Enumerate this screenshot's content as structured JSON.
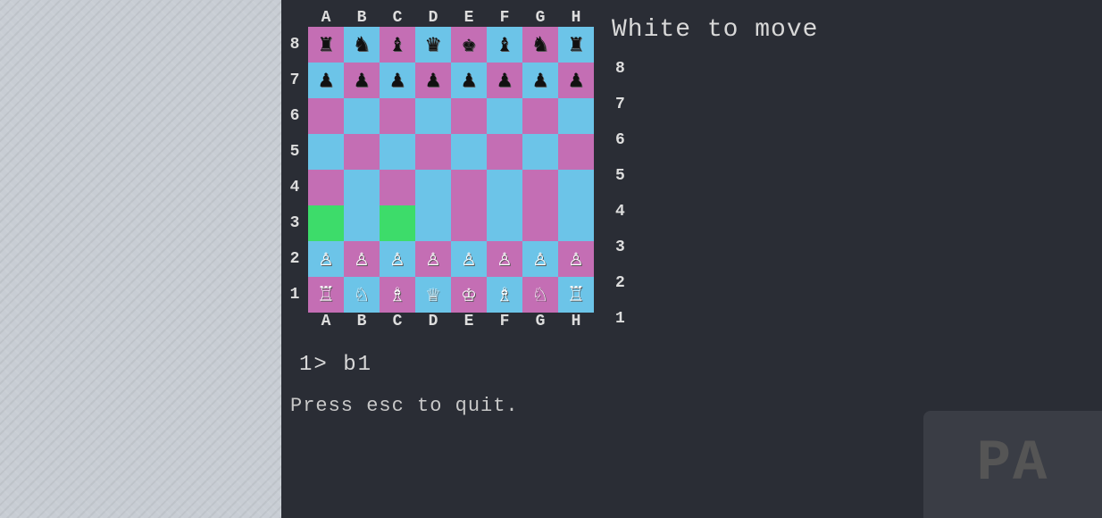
{
  "app": {
    "status": "White to move",
    "move_indicator": "1>  b1",
    "esc_hint": "Press esc to quit.",
    "pa_decor": "PA"
  },
  "board": {
    "col_labels": [
      "A",
      "B",
      "C",
      "D",
      "E",
      "F",
      "G",
      "H"
    ],
    "rows": [
      {
        "label": "8",
        "cells": [
          {
            "color": "dark",
            "piece": "♜",
            "side": "black"
          },
          {
            "color": "light",
            "piece": "♞",
            "side": "black"
          },
          {
            "color": "dark",
            "piece": "♝",
            "side": "black"
          },
          {
            "color": "light",
            "piece": "♛",
            "side": "black"
          },
          {
            "color": "dark",
            "piece": "♚",
            "side": "black"
          },
          {
            "color": "light",
            "piece": "♝",
            "side": "black"
          },
          {
            "color": "dark",
            "piece": "♞",
            "side": "black"
          },
          {
            "color": "light",
            "piece": "♜",
            "side": "black"
          }
        ]
      },
      {
        "label": "7",
        "cells": [
          {
            "color": "light",
            "piece": "♟",
            "side": "black"
          },
          {
            "color": "dark",
            "piece": "♟",
            "side": "black"
          },
          {
            "color": "light",
            "piece": "♟",
            "side": "black"
          },
          {
            "color": "dark",
            "piece": "♟",
            "side": "black"
          },
          {
            "color": "light",
            "piece": "♟",
            "side": "black"
          },
          {
            "color": "dark",
            "piece": "♟",
            "side": "black"
          },
          {
            "color": "light",
            "piece": "♟",
            "side": "black"
          },
          {
            "color": "dark",
            "piece": "♟",
            "side": "black"
          }
        ]
      },
      {
        "label": "6",
        "cells": [
          {
            "color": "dark",
            "piece": "",
            "side": ""
          },
          {
            "color": "light",
            "piece": "",
            "side": ""
          },
          {
            "color": "dark",
            "piece": "",
            "side": ""
          },
          {
            "color": "light",
            "piece": "",
            "side": ""
          },
          {
            "color": "dark",
            "piece": "",
            "side": ""
          },
          {
            "color": "light",
            "piece": "",
            "side": ""
          },
          {
            "color": "dark",
            "piece": "",
            "side": ""
          },
          {
            "color": "light",
            "piece": "",
            "side": ""
          }
        ]
      },
      {
        "label": "5",
        "cells": [
          {
            "color": "light",
            "piece": "",
            "side": ""
          },
          {
            "color": "dark",
            "piece": "",
            "side": ""
          },
          {
            "color": "light",
            "piece": "",
            "side": ""
          },
          {
            "color": "dark",
            "piece": "",
            "side": ""
          },
          {
            "color": "light",
            "piece": "",
            "side": ""
          },
          {
            "color": "dark",
            "piece": "",
            "side": ""
          },
          {
            "color": "light",
            "piece": "",
            "side": ""
          },
          {
            "color": "dark",
            "piece": "",
            "side": ""
          }
        ]
      },
      {
        "label": "4",
        "cells": [
          {
            "color": "dark",
            "piece": "",
            "side": ""
          },
          {
            "color": "light",
            "piece": "",
            "side": ""
          },
          {
            "color": "dark",
            "piece": "",
            "side": ""
          },
          {
            "color": "light",
            "piece": "",
            "side": ""
          },
          {
            "color": "dark",
            "piece": "",
            "side": ""
          },
          {
            "color": "light",
            "piece": "",
            "side": ""
          },
          {
            "color": "dark",
            "piece": "",
            "side": ""
          },
          {
            "color": "light",
            "piece": "",
            "side": ""
          }
        ]
      },
      {
        "label": "3",
        "cells": [
          {
            "color": "highlight",
            "piece": "",
            "side": ""
          },
          {
            "color": "light",
            "piece": "",
            "side": ""
          },
          {
            "color": "highlight",
            "piece": "",
            "side": ""
          },
          {
            "color": "light",
            "piece": "",
            "side": ""
          },
          {
            "color": "dark",
            "piece": "",
            "side": ""
          },
          {
            "color": "light",
            "piece": "",
            "side": ""
          },
          {
            "color": "dark",
            "piece": "",
            "side": ""
          },
          {
            "color": "light",
            "piece": "",
            "side": ""
          }
        ]
      },
      {
        "label": "2",
        "cells": [
          {
            "color": "light",
            "piece": "♙",
            "side": "white"
          },
          {
            "color": "dark",
            "piece": "♙",
            "side": "white"
          },
          {
            "color": "light",
            "piece": "♙",
            "side": "white"
          },
          {
            "color": "dark",
            "piece": "♙",
            "side": "white"
          },
          {
            "color": "light",
            "piece": "♙",
            "side": "white"
          },
          {
            "color": "dark",
            "piece": "♙",
            "side": "white"
          },
          {
            "color": "light",
            "piece": "♙",
            "side": "white"
          },
          {
            "color": "dark",
            "piece": "♙",
            "side": "white"
          }
        ]
      },
      {
        "label": "1",
        "cells": [
          {
            "color": "dark",
            "piece": "♖",
            "side": "white"
          },
          {
            "color": "light",
            "piece": "♘",
            "side": "white"
          },
          {
            "color": "dark",
            "piece": "♗",
            "side": "white"
          },
          {
            "color": "light",
            "piece": "♕",
            "side": "white"
          },
          {
            "color": "dark",
            "piece": "♔",
            "side": "white"
          },
          {
            "color": "light",
            "piece": "♗",
            "side": "white"
          },
          {
            "color": "dark",
            "piece": "♘",
            "side": "white"
          },
          {
            "color": "light",
            "piece": "♖",
            "side": "white"
          }
        ]
      }
    ]
  }
}
